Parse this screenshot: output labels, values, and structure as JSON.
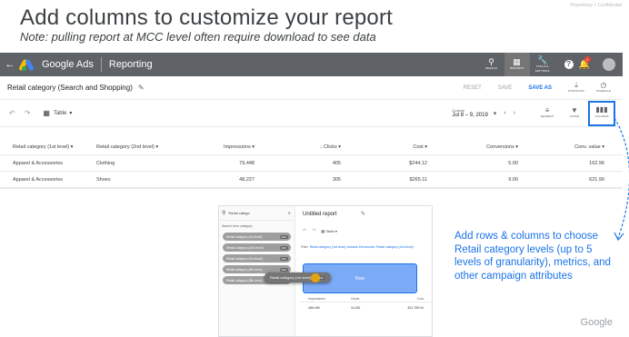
{
  "slide": {
    "title": "Add columns to customize your report",
    "subtitle": "Note: pulling report at MCC level often require download to see data",
    "confidential": "Proprietary + Confidential",
    "callout": "Add rows & columns to choose Retail category levels (up to 5 levels of granularity), metrics, and other campaign attributes",
    "watermark": "Google"
  },
  "topbar": {
    "back": "←",
    "app_name": "Google Ads",
    "section": "Reporting",
    "buttons": [
      {
        "icon": "search-icon",
        "label": "SEARCH"
      },
      {
        "icon": "reports-icon",
        "label": "REPORTS"
      },
      {
        "icon": "tools-icon",
        "label": "TOOLS & SETTINGS"
      }
    ],
    "notifications_count": "1"
  },
  "report_bar": {
    "title": "Retail category (Search and Shopping)",
    "reset": "RESET",
    "save": "SAVE",
    "save_as": "SAVE AS",
    "download": "DOWNLOAD",
    "schedule": "SCHEDULE"
  },
  "toolbar": {
    "view": "Table",
    "date_label": "Custom",
    "date_value": "Jul 8 – 9, 2019",
    "segment": "SEGMENT",
    "filter": "FILTER",
    "columns": "COLUMNS"
  },
  "table": {
    "headers": [
      "Retail category (1st level)",
      "Retail category (2nd level)",
      "Impressions",
      "↓ Clicks",
      "Cost",
      "Conversions",
      "Conv. value"
    ],
    "rows": [
      [
        "Apparel & Accessories",
        "Clothing",
        "79,448",
        "405",
        "$244.12",
        "5.00",
        "162.96"
      ],
      [
        "Apparel & Accessories",
        "Shoes",
        "48,227",
        "305",
        "$265.11",
        "9.00",
        "621.90"
      ]
    ]
  },
  "inset": {
    "search_value": "Retail catego",
    "section_label": "Search term category",
    "chips": [
      "Retail category (1st level)",
      "Retail category (2nd level)",
      "Retail category (3rd level)",
      "Retail category (4th level)",
      "Retail category (5th level)"
    ],
    "chip_tag": "DIM",
    "drag_chip": "Retail category (1st level)",
    "title": "Untitled report",
    "view": "Table",
    "filter_label": "Filter",
    "filter_value": "Retail category (1st level) includes Electronics; Retail category (2nd level)",
    "row_drop": "Row",
    "headers": [
      "Impressions",
      "Clicks",
      "Cost"
    ],
    "values": [
      "486,066",
      "34,361",
      "$12,785.94"
    ]
  }
}
